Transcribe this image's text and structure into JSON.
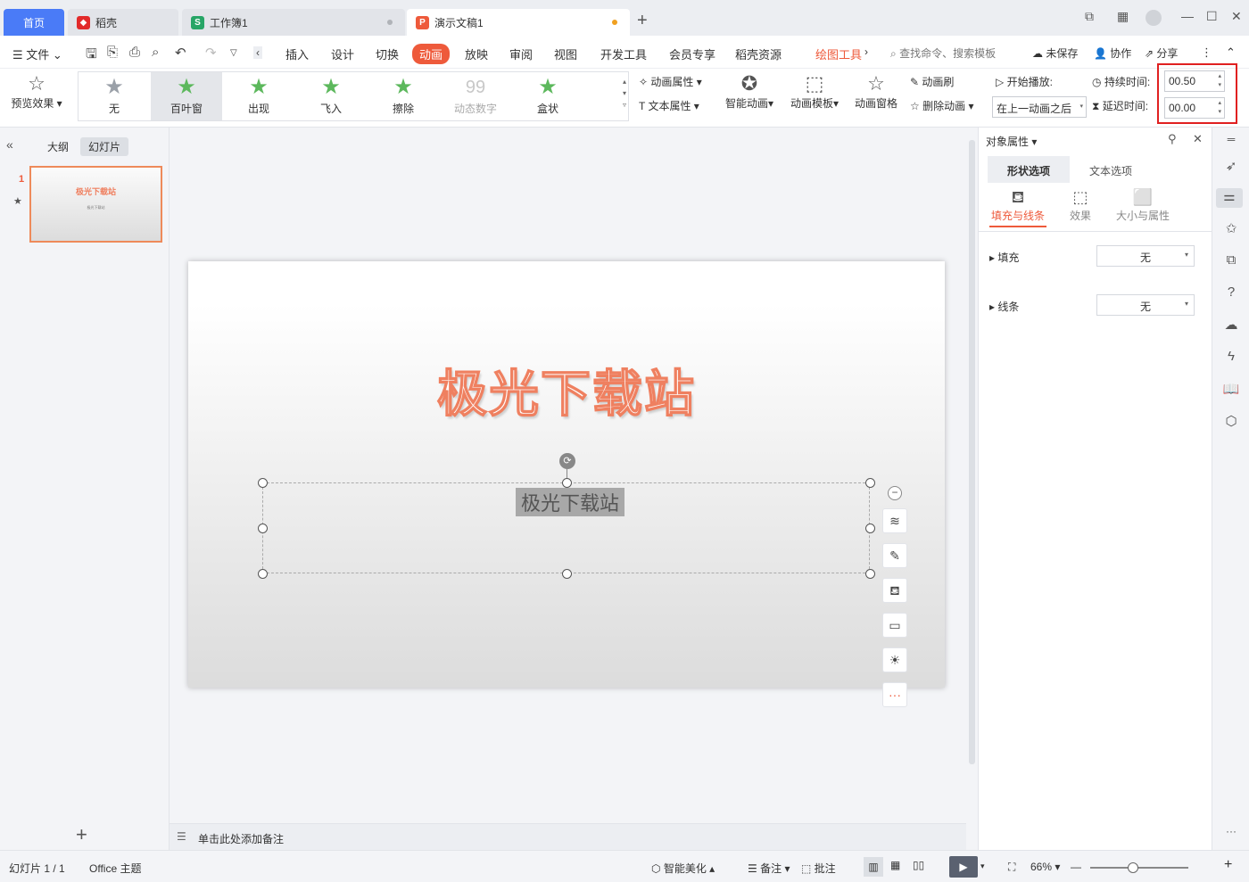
{
  "tabs": {
    "home": "首页",
    "docer": "稻壳",
    "workbook": "工作簿1",
    "presentation": "演示文稿1",
    "add": "+"
  },
  "menu": {
    "file": "文件",
    "items": [
      "插入",
      "设计",
      "切换",
      "动画",
      "放映",
      "审阅",
      "视图",
      "开发工具",
      "会员专享",
      "稻壳资源"
    ],
    "active": "动画",
    "drawing_tools": "绘图工具",
    "search": "查找命令、搜索模板",
    "unsaved": "未保存",
    "collab": "协作",
    "share": "分享"
  },
  "ribbon": {
    "preview": "预览效果",
    "gallery": [
      {
        "label": "无",
        "color": "#9aa0a8",
        "disabled": false
      },
      {
        "label": "百叶窗",
        "color": "#5cb85c",
        "disabled": false
      },
      {
        "label": "出现",
        "color": "#5cb85c",
        "disabled": false
      },
      {
        "label": "飞入",
        "color": "#5cb85c",
        "disabled": false
      },
      {
        "label": "擦除",
        "color": "#5cb85c",
        "disabled": false
      },
      {
        "label": "动态数字",
        "color": "#c8c8c8",
        "disabled": true
      },
      {
        "label": "盒状",
        "color": "#5cb85c",
        "disabled": false
      }
    ],
    "anim_props": "动画属性",
    "text_props": "文本属性",
    "smart_anim": "智能动画",
    "anim_template": "动画模板",
    "anim_pane": "动画窗格",
    "anim_brush": "动画刷",
    "delete_anim": "删除动画",
    "start_play": "开始播放:",
    "start_value": "在上一动画之后",
    "duration_label": "持续时间:",
    "duration_value": "00.50",
    "delay_label": "延迟时间:",
    "delay_value": "00.00"
  },
  "left_panel": {
    "outline": "大纲",
    "slides": "幻灯片",
    "slide_number": "1",
    "thumb_title": "极光下载站",
    "thumb_sub": "极光下载站"
  },
  "slide": {
    "title": "极光下载站",
    "subtitle": "极光下载站"
  },
  "notes_placeholder": "单击此处添加备注",
  "right_panel": {
    "title": "对象属性",
    "tab_shape": "形状选项",
    "tab_text": "文本选项",
    "sub_fill": "填充与线条",
    "sub_effect": "效果",
    "sub_size": "大小与属性",
    "fill_label": "填充",
    "fill_value": "无",
    "line_label": "线条",
    "line_value": "无"
  },
  "status": {
    "slide_info": "幻灯片 1 / 1",
    "theme": "Office 主题",
    "smart_beautify": "智能美化",
    "notes": "备注",
    "comments": "批注",
    "zoom": "66%"
  },
  "colors": {
    "accent": "#ee5a3b",
    "home_tab": "#4a7bf7",
    "highlight_border": "#e02020"
  }
}
